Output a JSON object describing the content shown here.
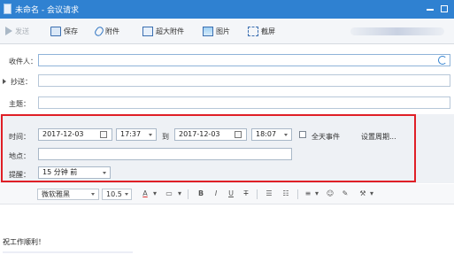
{
  "window": {
    "title": "未命名 - 会议请求",
    "title_bg": "#2f81d1",
    "icons": [
      "app-icon",
      "minimize-icon",
      "close-icon"
    ]
  },
  "toolbar": {
    "send_label": "发送",
    "save_label": "保存",
    "attach_label": "附件",
    "big_attach_label": "超大附件",
    "image_label": "图片",
    "screenshot_label": "截屏"
  },
  "header": {
    "to_label": "收件人：",
    "cc_label": "抄送：",
    "subject_label": "主题："
  },
  "meeting": {
    "time_label": "时间：",
    "start_date": "2017-12-03",
    "start_time": "17:37",
    "to_word": "到",
    "end_date": "2017-12-03",
    "end_time": "18:07",
    "all_day_label": "全天事件",
    "recurrence_label": "设置周期...",
    "location_label": "地点：",
    "reminder_label": "提醒：",
    "reminder_value": "15 分钟 前",
    "highlight_color": "#e01f26"
  },
  "format": {
    "font_name": "微软雅黑",
    "font_size": "10.5",
    "font_color_label": "A",
    "bold_label": "B",
    "italic_label": "I",
    "underline_label": "U",
    "strike_label": "T"
  },
  "body": {
    "text": "祝工作顺利！"
  }
}
